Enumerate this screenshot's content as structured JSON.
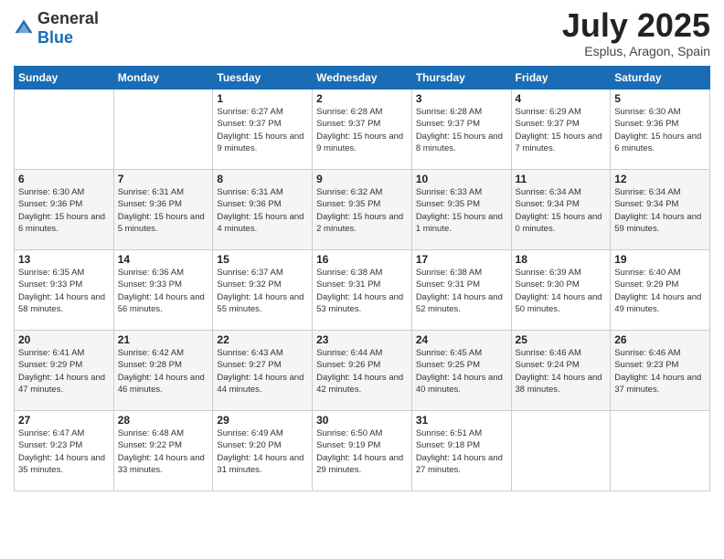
{
  "header": {
    "logo_general": "General",
    "logo_blue": "Blue",
    "month_title": "July 2025",
    "location": "Esplus, Aragon, Spain"
  },
  "weekdays": [
    "Sunday",
    "Monday",
    "Tuesday",
    "Wednesday",
    "Thursday",
    "Friday",
    "Saturday"
  ],
  "weeks": [
    [
      {
        "day": "",
        "info": ""
      },
      {
        "day": "",
        "info": ""
      },
      {
        "day": "1",
        "info": "Sunrise: 6:27 AM\nSunset: 9:37 PM\nDaylight: 15 hours and 9 minutes."
      },
      {
        "day": "2",
        "info": "Sunrise: 6:28 AM\nSunset: 9:37 PM\nDaylight: 15 hours and 9 minutes."
      },
      {
        "day": "3",
        "info": "Sunrise: 6:28 AM\nSunset: 9:37 PM\nDaylight: 15 hours and 8 minutes."
      },
      {
        "day": "4",
        "info": "Sunrise: 6:29 AM\nSunset: 9:37 PM\nDaylight: 15 hours and 7 minutes."
      },
      {
        "day": "5",
        "info": "Sunrise: 6:30 AM\nSunset: 9:36 PM\nDaylight: 15 hours and 6 minutes."
      }
    ],
    [
      {
        "day": "6",
        "info": "Sunrise: 6:30 AM\nSunset: 9:36 PM\nDaylight: 15 hours and 6 minutes."
      },
      {
        "day": "7",
        "info": "Sunrise: 6:31 AM\nSunset: 9:36 PM\nDaylight: 15 hours and 5 minutes."
      },
      {
        "day": "8",
        "info": "Sunrise: 6:31 AM\nSunset: 9:36 PM\nDaylight: 15 hours and 4 minutes."
      },
      {
        "day": "9",
        "info": "Sunrise: 6:32 AM\nSunset: 9:35 PM\nDaylight: 15 hours and 2 minutes."
      },
      {
        "day": "10",
        "info": "Sunrise: 6:33 AM\nSunset: 9:35 PM\nDaylight: 15 hours and 1 minute."
      },
      {
        "day": "11",
        "info": "Sunrise: 6:34 AM\nSunset: 9:34 PM\nDaylight: 15 hours and 0 minutes."
      },
      {
        "day": "12",
        "info": "Sunrise: 6:34 AM\nSunset: 9:34 PM\nDaylight: 14 hours and 59 minutes."
      }
    ],
    [
      {
        "day": "13",
        "info": "Sunrise: 6:35 AM\nSunset: 9:33 PM\nDaylight: 14 hours and 58 minutes."
      },
      {
        "day": "14",
        "info": "Sunrise: 6:36 AM\nSunset: 9:33 PM\nDaylight: 14 hours and 56 minutes."
      },
      {
        "day": "15",
        "info": "Sunrise: 6:37 AM\nSunset: 9:32 PM\nDaylight: 14 hours and 55 minutes."
      },
      {
        "day": "16",
        "info": "Sunrise: 6:38 AM\nSunset: 9:31 PM\nDaylight: 14 hours and 53 minutes."
      },
      {
        "day": "17",
        "info": "Sunrise: 6:38 AM\nSunset: 9:31 PM\nDaylight: 14 hours and 52 minutes."
      },
      {
        "day": "18",
        "info": "Sunrise: 6:39 AM\nSunset: 9:30 PM\nDaylight: 14 hours and 50 minutes."
      },
      {
        "day": "19",
        "info": "Sunrise: 6:40 AM\nSunset: 9:29 PM\nDaylight: 14 hours and 49 minutes."
      }
    ],
    [
      {
        "day": "20",
        "info": "Sunrise: 6:41 AM\nSunset: 9:29 PM\nDaylight: 14 hours and 47 minutes."
      },
      {
        "day": "21",
        "info": "Sunrise: 6:42 AM\nSunset: 9:28 PM\nDaylight: 14 hours and 46 minutes."
      },
      {
        "day": "22",
        "info": "Sunrise: 6:43 AM\nSunset: 9:27 PM\nDaylight: 14 hours and 44 minutes."
      },
      {
        "day": "23",
        "info": "Sunrise: 6:44 AM\nSunset: 9:26 PM\nDaylight: 14 hours and 42 minutes."
      },
      {
        "day": "24",
        "info": "Sunrise: 6:45 AM\nSunset: 9:25 PM\nDaylight: 14 hours and 40 minutes."
      },
      {
        "day": "25",
        "info": "Sunrise: 6:46 AM\nSunset: 9:24 PM\nDaylight: 14 hours and 38 minutes."
      },
      {
        "day": "26",
        "info": "Sunrise: 6:46 AM\nSunset: 9:23 PM\nDaylight: 14 hours and 37 minutes."
      }
    ],
    [
      {
        "day": "27",
        "info": "Sunrise: 6:47 AM\nSunset: 9:23 PM\nDaylight: 14 hours and 35 minutes."
      },
      {
        "day": "28",
        "info": "Sunrise: 6:48 AM\nSunset: 9:22 PM\nDaylight: 14 hours and 33 minutes."
      },
      {
        "day": "29",
        "info": "Sunrise: 6:49 AM\nSunset: 9:20 PM\nDaylight: 14 hours and 31 minutes."
      },
      {
        "day": "30",
        "info": "Sunrise: 6:50 AM\nSunset: 9:19 PM\nDaylight: 14 hours and 29 minutes."
      },
      {
        "day": "31",
        "info": "Sunrise: 6:51 AM\nSunset: 9:18 PM\nDaylight: 14 hours and 27 minutes."
      },
      {
        "day": "",
        "info": ""
      },
      {
        "day": "",
        "info": ""
      }
    ]
  ]
}
